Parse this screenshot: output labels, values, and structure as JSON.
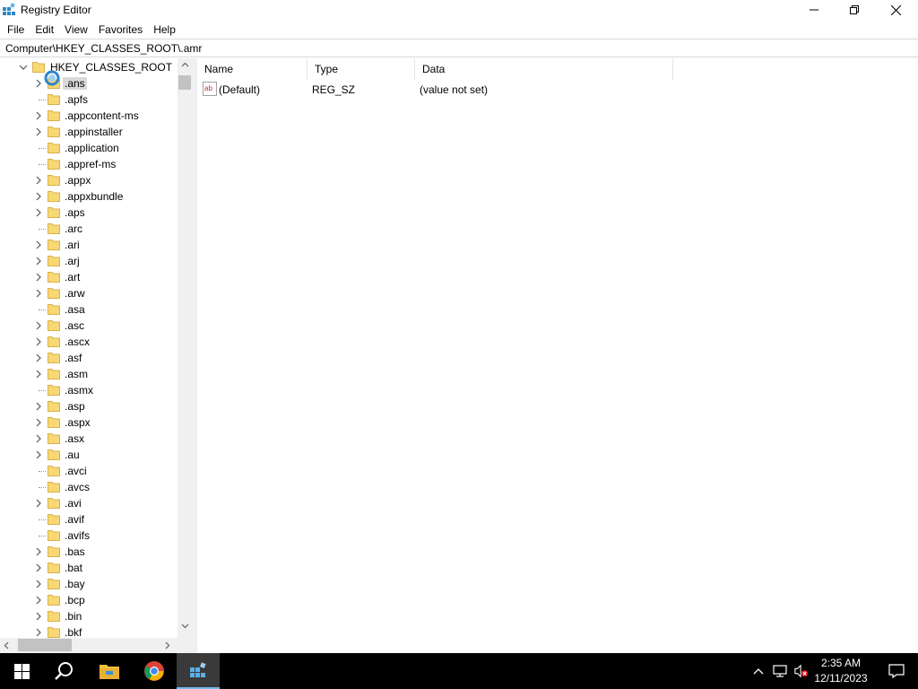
{
  "window": {
    "title": "Registry Editor",
    "menu": [
      "File",
      "Edit",
      "View",
      "Favorites",
      "Help"
    ],
    "address": "Computer\\HKEY_CLASSES_ROOT\\.amr"
  },
  "tree": {
    "root_label": "HKEY_CLASSES_ROOT",
    "items": [
      {
        "label": ".ans",
        "expandable": true,
        "selected": true
      },
      {
        "label": ".apfs",
        "expandable": false
      },
      {
        "label": ".appcontent-ms",
        "expandable": true
      },
      {
        "label": ".appinstaller",
        "expandable": true
      },
      {
        "label": ".application",
        "expandable": false
      },
      {
        "label": ".appref-ms",
        "expandable": false
      },
      {
        "label": ".appx",
        "expandable": true
      },
      {
        "label": ".appxbundle",
        "expandable": true
      },
      {
        "label": ".aps",
        "expandable": true
      },
      {
        "label": ".arc",
        "expandable": false
      },
      {
        "label": ".ari",
        "expandable": true
      },
      {
        "label": ".arj",
        "expandable": true
      },
      {
        "label": ".art",
        "expandable": true
      },
      {
        "label": ".arw",
        "expandable": true
      },
      {
        "label": ".asa",
        "expandable": false
      },
      {
        "label": ".asc",
        "expandable": true
      },
      {
        "label": ".ascx",
        "expandable": true
      },
      {
        "label": ".asf",
        "expandable": true
      },
      {
        "label": ".asm",
        "expandable": true
      },
      {
        "label": ".asmx",
        "expandable": false
      },
      {
        "label": ".asp",
        "expandable": true
      },
      {
        "label": ".aspx",
        "expandable": true
      },
      {
        "label": ".asx",
        "expandable": true
      },
      {
        "label": ".au",
        "expandable": true
      },
      {
        "label": ".avci",
        "expandable": false
      },
      {
        "label": ".avcs",
        "expandable": false
      },
      {
        "label": ".avi",
        "expandable": true
      },
      {
        "label": ".avif",
        "expandable": false
      },
      {
        "label": ".avifs",
        "expandable": false
      },
      {
        "label": ".bas",
        "expandable": true
      },
      {
        "label": ".bat",
        "expandable": true
      },
      {
        "label": ".bay",
        "expandable": true
      },
      {
        "label": ".bcp",
        "expandable": true
      },
      {
        "label": ".bin",
        "expandable": true
      },
      {
        "label": ".bkf",
        "expandable": true
      }
    ]
  },
  "list": {
    "columns": {
      "name": "Name",
      "type": "Type",
      "data": "Data"
    },
    "rows": [
      {
        "name": "(Default)",
        "type": "REG_SZ",
        "data": "(value not set)"
      }
    ]
  },
  "taskbar": {
    "time": "2:35 AM",
    "date": "12/11/2023"
  },
  "colors": {
    "taskbar_bg": "#000000",
    "active_underline": "#76b9ed",
    "selection_bg": "#d9d9d9",
    "folder_fill": "#f8d775"
  },
  "icons": {
    "app": "registry-icon",
    "tree_item": "folder-icon",
    "value": "reg-sz-icon"
  }
}
